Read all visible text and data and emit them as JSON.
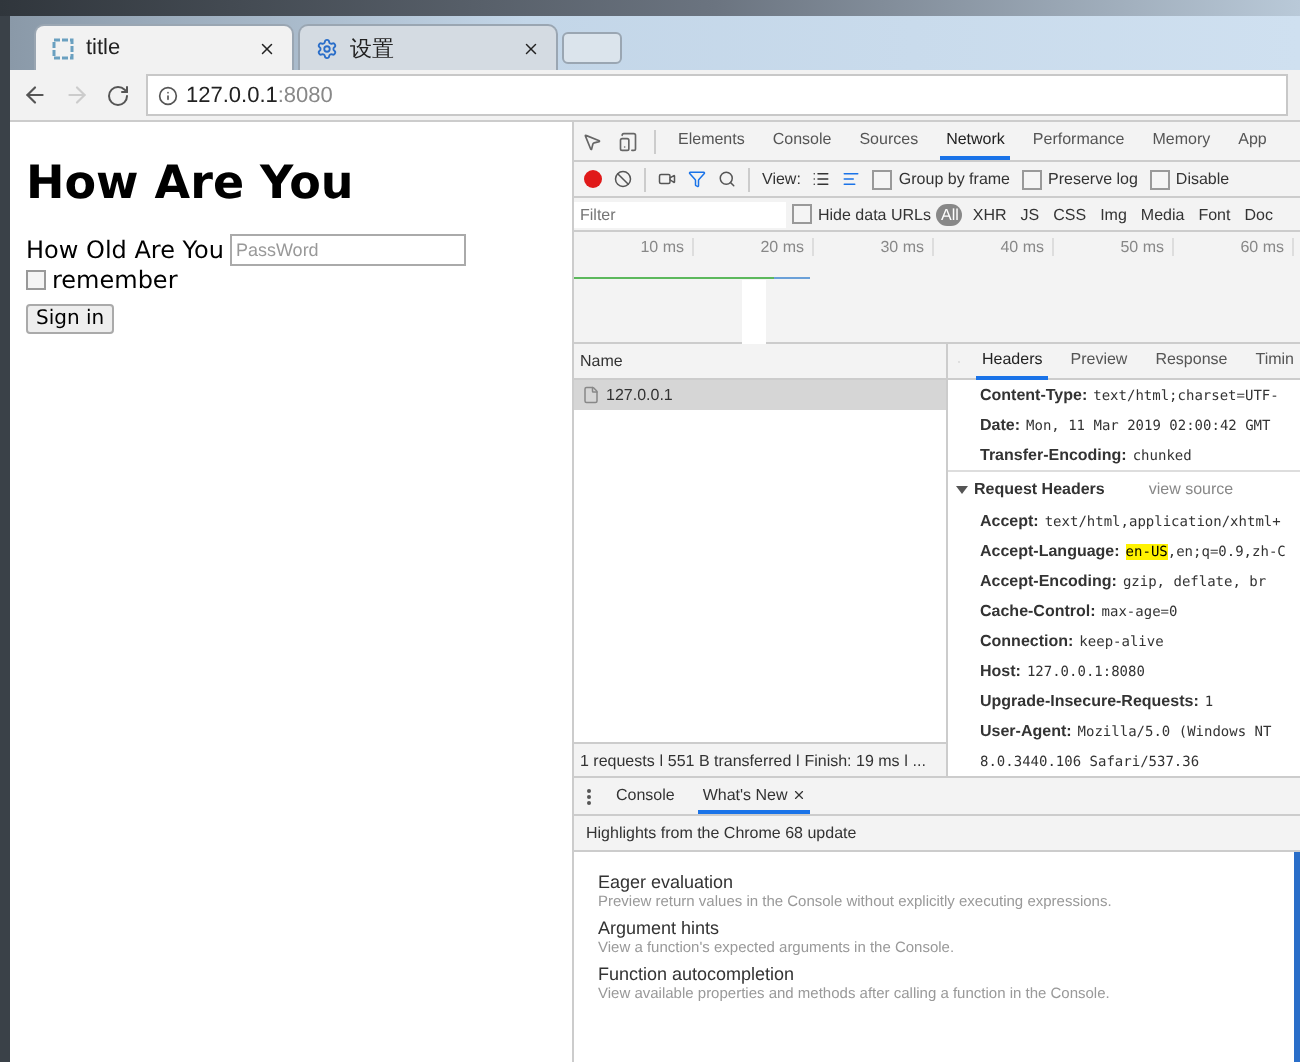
{
  "browser": {
    "tabs": [
      {
        "title": "title",
        "selected": true,
        "kind": "page"
      },
      {
        "title": "设置",
        "selected": false,
        "kind": "settings"
      }
    ],
    "address": {
      "host": "127.0.0.1",
      "port": ":8080"
    },
    "nav": {
      "back_disabled": false,
      "forward_disabled": true
    }
  },
  "page": {
    "heading": "How Are You",
    "field_label": "How Old Are You",
    "password_placeholder": "PassWord",
    "remember": {
      "label": "remember",
      "checked": false
    },
    "submit": "Sign in"
  },
  "devtools": {
    "tabs": [
      {
        "label": "Elements",
        "selected": false
      },
      {
        "label": "Console",
        "selected": false
      },
      {
        "label": "Sources",
        "selected": false
      },
      {
        "label": "Network",
        "selected": true
      },
      {
        "label": "Performance",
        "selected": false
      },
      {
        "label": "Memory",
        "selected": false
      },
      {
        "label": "App",
        "selected": false
      }
    ],
    "toolbar": {
      "recording": true,
      "filter_active": true,
      "view_label": "View:",
      "options": [
        {
          "label": "Group by frame",
          "checked": false
        },
        {
          "label": "Preserve log",
          "checked": false
        },
        {
          "label": "Disable",
          "checked": false
        }
      ]
    },
    "filter": {
      "placeholder": "Filter",
      "hide_data_urls": {
        "label": "Hide data URLs",
        "checked": false
      },
      "types": [
        {
          "label": "All",
          "selected": true
        },
        {
          "label": "XHR",
          "selected": false
        },
        {
          "label": "JS",
          "selected": false
        },
        {
          "label": "CSS",
          "selected": false
        },
        {
          "label": "Img",
          "selected": false
        },
        {
          "label": "Media",
          "selected": false
        },
        {
          "label": "Font",
          "selected": false
        },
        {
          "label": "Doc",
          "selected": false
        }
      ]
    },
    "timeline": {
      "ticks": [
        "10 ms",
        "20 ms",
        "30 ms",
        "40 ms",
        "50 ms",
        "60 ms"
      ]
    },
    "requests": {
      "column": "Name",
      "rows": [
        {
          "name": "127.0.0.1",
          "selected": true
        }
      ],
      "summary": "1 requests ǀ 551 B transferred ǀ Finish: 19 ms ǀ ..."
    },
    "details": {
      "tabs": [
        {
          "label": "Headers",
          "selected": true
        },
        {
          "label": "Preview",
          "selected": false
        },
        {
          "label": "Response",
          "selected": false
        },
        {
          "label": "Timin",
          "selected": false
        }
      ],
      "response_headers": [
        {
          "name": "Content-Type:",
          "value": "text/html;charset=UTF-"
        },
        {
          "name": "Date:",
          "value": "Mon, 11 Mar 2019 02:00:42 GMT"
        },
        {
          "name": "Transfer-Encoding:",
          "value": "chunked"
        }
      ],
      "request_section": {
        "title": "Request Headers",
        "expanded": true,
        "link": "view source"
      },
      "request_headers": [
        {
          "name": "Accept:",
          "value": "text/html,application/xhtml+"
        },
        {
          "name": "Accept-Language:",
          "highlight": "en-US",
          "value": ",en;q=0.9,zh-C"
        },
        {
          "name": "Accept-Encoding:",
          "value": "gzip, deflate, br"
        },
        {
          "name": "Cache-Control:",
          "value": "max-age=0"
        },
        {
          "name": "Connection:",
          "value": "keep-alive"
        },
        {
          "name": "Host:",
          "value": "127.0.0.1:8080"
        },
        {
          "name": "Upgrade-Insecure-Requests:",
          "value": "1"
        },
        {
          "name": "User-Agent:",
          "value": "Mozilla/5.0 (Windows NT"
        }
      ],
      "continuation": "8.0.3440.106 Safari/537.36"
    }
  },
  "drawer": {
    "tabs": [
      {
        "label": "Console",
        "selected": false,
        "closable": false
      },
      {
        "label": "What's New",
        "selected": true,
        "closable": true
      }
    ],
    "banner": "Highlights from the Chrome 68 update",
    "items": [
      {
        "title": "Eager evaluation",
        "text": "Preview return values in the Console without explicitly executing expressions."
      },
      {
        "title": "Argument hints",
        "text": "View a function's expected arguments in the Console."
      },
      {
        "title": "Function autocompletion",
        "text": "View available properties and methods after calling a function in the Console."
      }
    ]
  }
}
